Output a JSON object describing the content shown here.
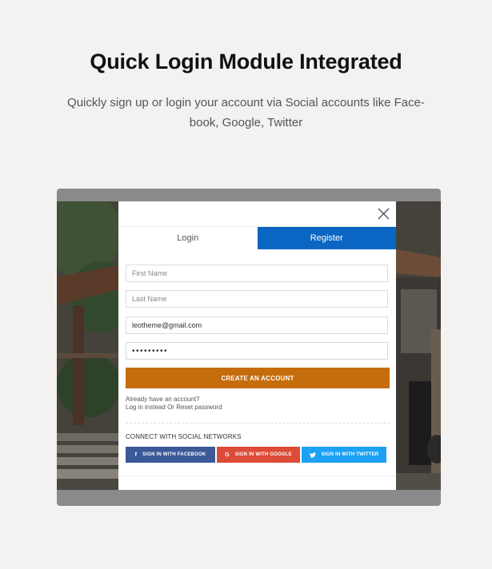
{
  "header": {
    "title": "Quick Login Module Integrated",
    "subtitle_line1": "Quickly sign up or login your account via Social accounts like Face-",
    "subtitle_line2": "book, Google, Twitter"
  },
  "modal": {
    "close_icon": "close-icon",
    "tabs": [
      {
        "label": "Login",
        "active": false
      },
      {
        "label": "Register",
        "active": true
      }
    ],
    "fields": {
      "first_name_placeholder": "First Name",
      "last_name_placeholder": "Last Name",
      "email_value": "leotheme@gmail.com",
      "password_value": "•••••••••"
    },
    "create_button": "CREATE AN ACCOUNT",
    "already_text": "Already have an account?",
    "login_link": "Log in instead",
    "or_text": "Or",
    "reset_link": "Reset password",
    "social_heading": "CONNECT WITH SOCIAL NETWORKS",
    "social_buttons": {
      "facebook": {
        "label": "SIGN IN WITH FACEBOOK",
        "icon": "f",
        "color": "#3b5998"
      },
      "google": {
        "label": "SIGN IN WITH GOOGLE",
        "icon": "G",
        "color": "#dd4b39"
      },
      "twitter": {
        "label": "SIGN IN WITH TWITTER",
        "icon": "twitter-icon",
        "color": "#1da1f2"
      }
    }
  },
  "colors": {
    "accent_tab": "#0a66c2",
    "create_button": "#c56c0d"
  }
}
